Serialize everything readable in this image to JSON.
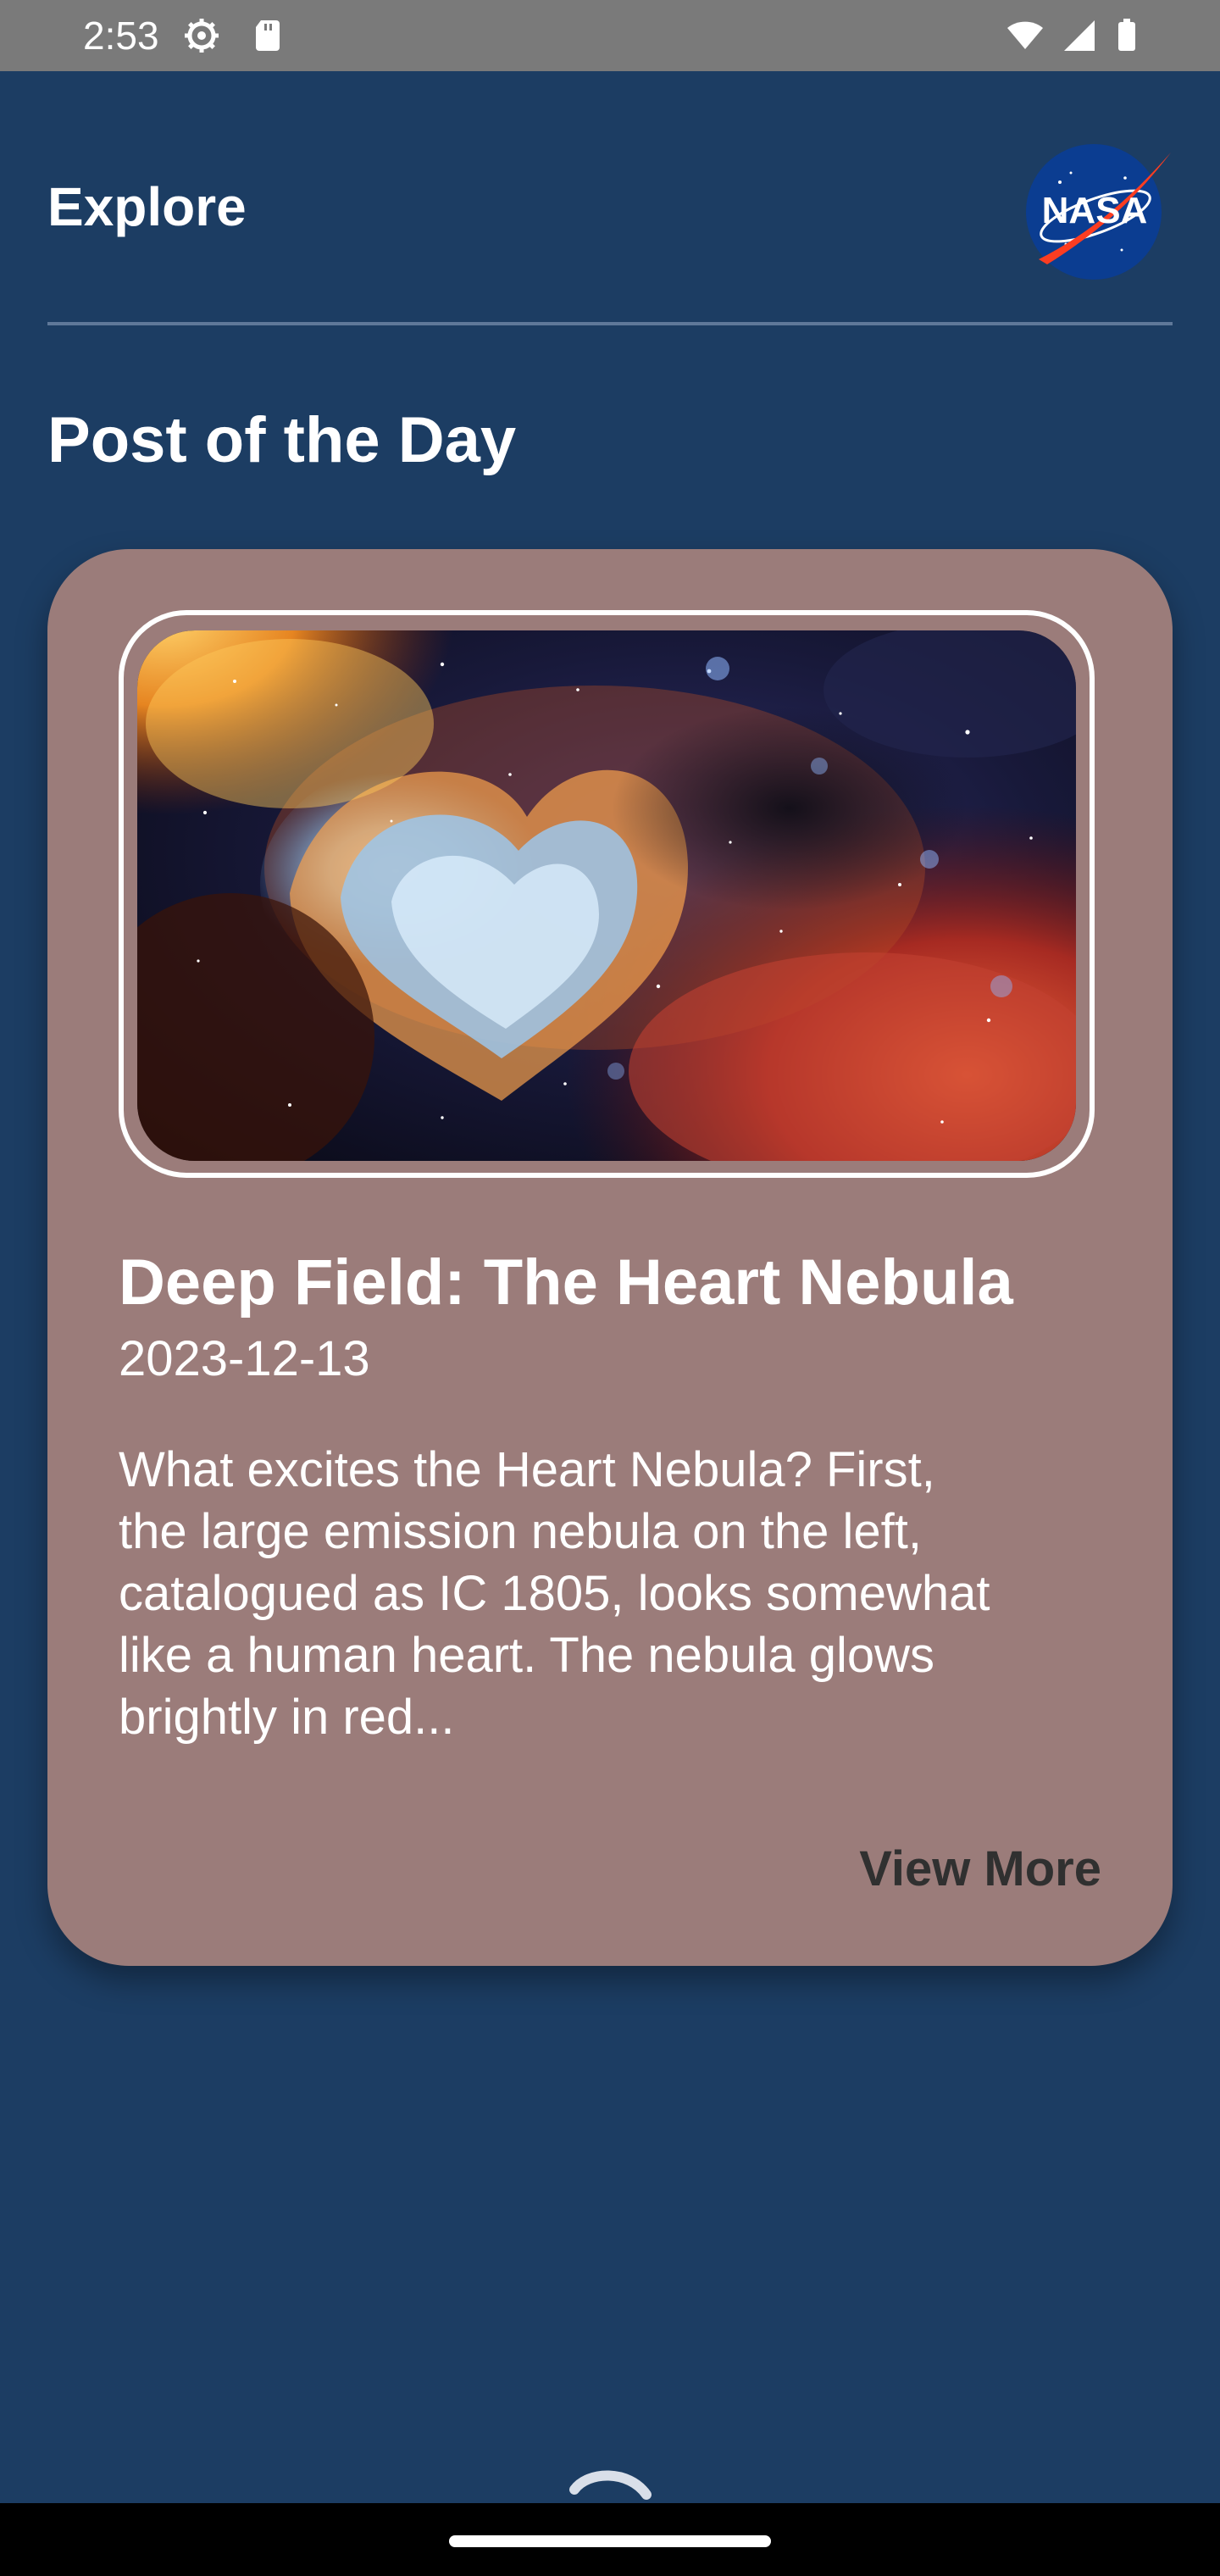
{
  "status_bar": {
    "time": "2:53",
    "icons": [
      "settings-gear-icon",
      "sd-card-icon",
      "wifi-icon",
      "cell-signal-icon",
      "battery-icon"
    ]
  },
  "header": {
    "title": "Explore",
    "logo": {
      "name": "nasa-logo",
      "text": "NASA"
    }
  },
  "section": {
    "title": "Post of the Day"
  },
  "post": {
    "title": "Deep Field: The Heart Nebula",
    "date": "2023-12-13",
    "excerpt": "What excites the Heart Nebula? First,\nthe large emission nebula on the left,\ncatalogued as IC 1805, looks somewhat\nlike a human heart.  The nebula glows\nbrightly in red...",
    "view_more_label": "View More"
  },
  "colors": {
    "background": "#1c3d63",
    "status_bar": "#7a7a7a",
    "card": "#9b7c7a",
    "text_primary": "#ffffff",
    "link_text": "#303030",
    "divider": "#5f7899"
  }
}
